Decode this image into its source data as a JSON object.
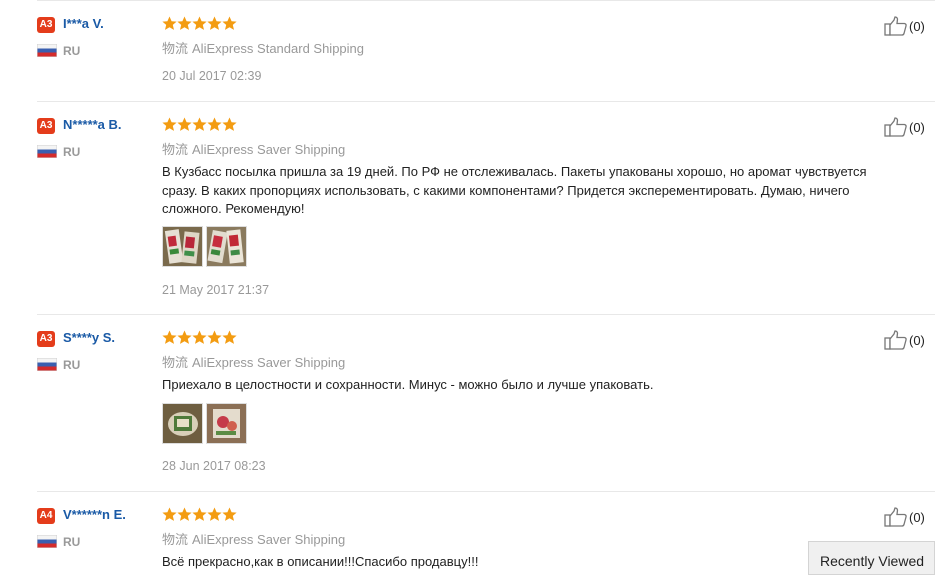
{
  "shipping_tag": "物流",
  "recently_viewed_label": "Recently Viewed",
  "colors": {
    "badge": "#e43c1b",
    "star": "#f39c12",
    "username": "#1a5aa6"
  },
  "reviews": [
    {
      "level": "A3",
      "username": "I***a V.",
      "country": "RU",
      "rating": 5,
      "shipping": "AliExpress Standard Shipping",
      "text": "",
      "photos": 0,
      "date": "20 Jul 2017 02:39",
      "helpful": "(0)"
    },
    {
      "level": "A3",
      "username": "N*****a B.",
      "country": "RU",
      "rating": 5,
      "shipping": "AliExpress Saver Shipping",
      "text": "В Кузбасс посылка пришла за 19 дней. По РФ не отслеживалась. Пакеты упакованы хорошо, но аромат чувствуется сразу. В каких пропорциях использовать, с какими компонентами? Придется эксперементировать. Думаю, ничего сложного. Рекомендую!",
      "photos": 2,
      "date": "21 May 2017 21:37",
      "helpful": "(0)"
    },
    {
      "level": "A3",
      "username": "S****y S.",
      "country": "RU",
      "rating": 5,
      "shipping": "AliExpress Saver Shipping",
      "text": "Приехало в целостности и сохранности. Минус - можно было и лучше упаковать.",
      "photos": 2,
      "date": "28 Jun 2017 08:23",
      "helpful": "(0)"
    },
    {
      "level": "A4",
      "username": "V******n E.",
      "country": "RU",
      "rating": 5,
      "shipping": "AliExpress Saver Shipping",
      "text": "Всё прекрасно,как в описании!!!Спасибо продавцу!!!",
      "photos": 0,
      "date": "",
      "helpful": "(0)"
    }
  ]
}
